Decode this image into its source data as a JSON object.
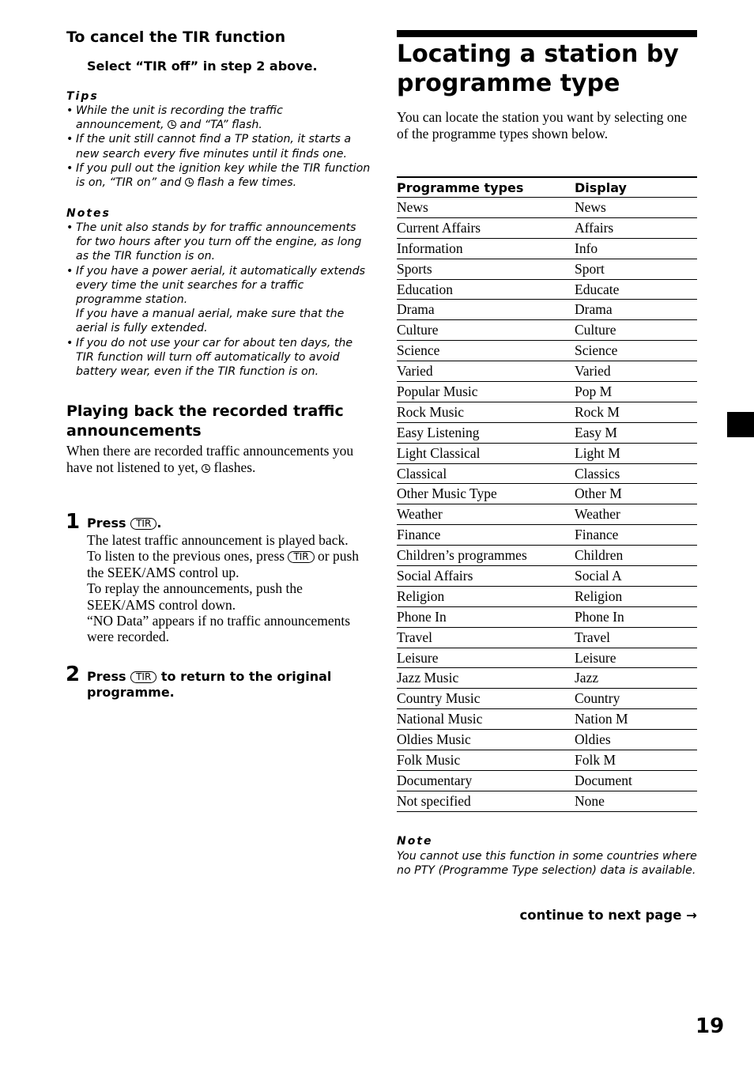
{
  "left": {
    "cancel_heading": "To cancel the TIR function",
    "cancel_step": "Select “TIR off” in step 2 above.",
    "tips_label": "Tips",
    "tips": [
      {
        "pre": "While the unit is recording the traffic announcement, ",
        "icon": "clock-icon",
        "post": " and “TA” flash."
      },
      {
        "pre": "If the unit still cannot find a TP station, it starts a new search every five minutes until it finds one.",
        "icon": null,
        "post": ""
      },
      {
        "pre": "If you pull out the ignition key while the TIR function is on, “TIR on” and ",
        "icon": "clock-icon",
        "post": " flash a few times."
      }
    ],
    "notes_label": "Notes",
    "notes": [
      {
        "text": "The unit also stands by for traffic announcements for two hours after you turn off the engine, as long as the TIR function is on."
      },
      {
        "text": "If you have a power aerial, it automatically extends every time the unit searches for a traffic programme station.",
        "extra": "If you have a manual aerial, make sure that the aerial is fully extended."
      },
      {
        "text": "If you do not use your car for about ten days, the TIR function will turn off automatically to avoid battery wear, even if the TIR function is on."
      }
    ],
    "playback_heading": "Playing back the recorded traffic announcements",
    "playback_body_pre": "When there are recorded traffic announcements you have not listened to yet, ",
    "playback_body_post": " flashes.",
    "step1": {
      "number": "1",
      "head_pre": "Press ",
      "key": "TIR",
      "head_post": ".",
      "body_a": "The latest traffic announcement is played back. To listen to the previous ones, press ",
      "body_key": "TIR",
      "body_b": " or push the SEEK/AMS control up.",
      "body_c": "To replay the announcements, push the SEEK/AMS control down.",
      "body_d": "“NO Data” appears if no traffic announcements were recorded."
    },
    "step2": {
      "number": "2",
      "head_pre": "Press ",
      "key": "TIR",
      "head_post": " to return to the original programme."
    }
  },
  "right": {
    "heading": "Locating a station by programme type",
    "intro": "You can locate the station you want by selecting one of the programme types shown below.",
    "table": {
      "headers": [
        "Programme types",
        "Display"
      ],
      "rows": [
        [
          "News",
          "News"
        ],
        [
          "Current Affairs",
          "Affairs"
        ],
        [
          "Information",
          "Info"
        ],
        [
          "Sports",
          "Sport"
        ],
        [
          "Education",
          "Educate"
        ],
        [
          "Drama",
          "Drama"
        ],
        [
          "Culture",
          "Culture"
        ],
        [
          "Science",
          "Science"
        ],
        [
          "Varied",
          "Varied"
        ],
        [
          "Popular Music",
          "Pop M"
        ],
        [
          "Rock Music",
          "Rock M"
        ],
        [
          "Easy Listening",
          "Easy M"
        ],
        [
          "Light Classical",
          "Light M"
        ],
        [
          "Classical",
          "Classics"
        ],
        [
          "Other Music Type",
          "Other M"
        ],
        [
          "Weather",
          "Weather"
        ],
        [
          "Finance",
          "Finance"
        ],
        [
          "Children’s programmes",
          "Children"
        ],
        [
          "Social Affairs",
          "Social A"
        ],
        [
          "Religion",
          "Religion"
        ],
        [
          "Phone In",
          "Phone In"
        ],
        [
          "Travel",
          "Travel"
        ],
        [
          "Leisure",
          "Leisure"
        ],
        [
          "Jazz Music",
          "Jazz"
        ],
        [
          "Country Music",
          "Country"
        ],
        [
          "National Music",
          "Nation M"
        ],
        [
          "Oldies Music",
          "Oldies"
        ],
        [
          "Folk Music",
          "Folk M"
        ],
        [
          "Documentary",
          "Document"
        ],
        [
          "Not specified",
          "None"
        ]
      ]
    },
    "note_label": "Note",
    "note_body": "You cannot use this function in some countries where no PTY (Programme Type selection) data is available.",
    "continue": "continue to next page →"
  },
  "page_number": "19"
}
